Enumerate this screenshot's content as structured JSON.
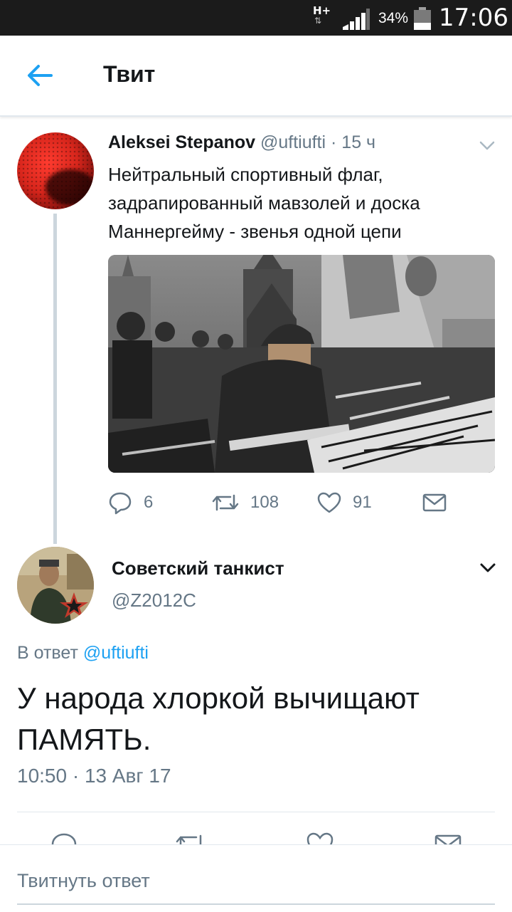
{
  "status_bar": {
    "network": "H+",
    "battery_percent": "34%",
    "time": "17:06",
    "signal_bars": 4,
    "battery_level": 0.34
  },
  "header": {
    "title": "Твит"
  },
  "original_tweet": {
    "author_name": "Aleksei Stepanov",
    "handle": "@uftiufti",
    "time_ago": "· 15 ч",
    "text": "Нейтральный спортивный флаг, задрапированный мавзолей и доска Маннергейму - звенья одной цепи",
    "replies": "6",
    "retweets": "108",
    "likes": "91"
  },
  "reply_tweet": {
    "author_name": "Советский танкист",
    "handle": "@Z2012C",
    "reply_label": "В ответ",
    "reply_to_handle": "@uftiufti",
    "text": "У народа хлоркой вычищают ПАМЯТЬ.",
    "timestamp": "10:50 · 13 Авг 17"
  },
  "compose": {
    "placeholder": "Твитнуть ответ"
  },
  "colors": {
    "accent": "#1da1f2",
    "secondary_text": "#657786",
    "divider": "#e1e8ed",
    "status_bar": "#1b1b1b"
  },
  "icons": {
    "back": "arrow-left-icon",
    "caret": "chevron-down-icon",
    "reply": "reply-icon",
    "retweet": "retweet-icon",
    "like": "heart-icon",
    "dm": "envelope-icon"
  }
}
